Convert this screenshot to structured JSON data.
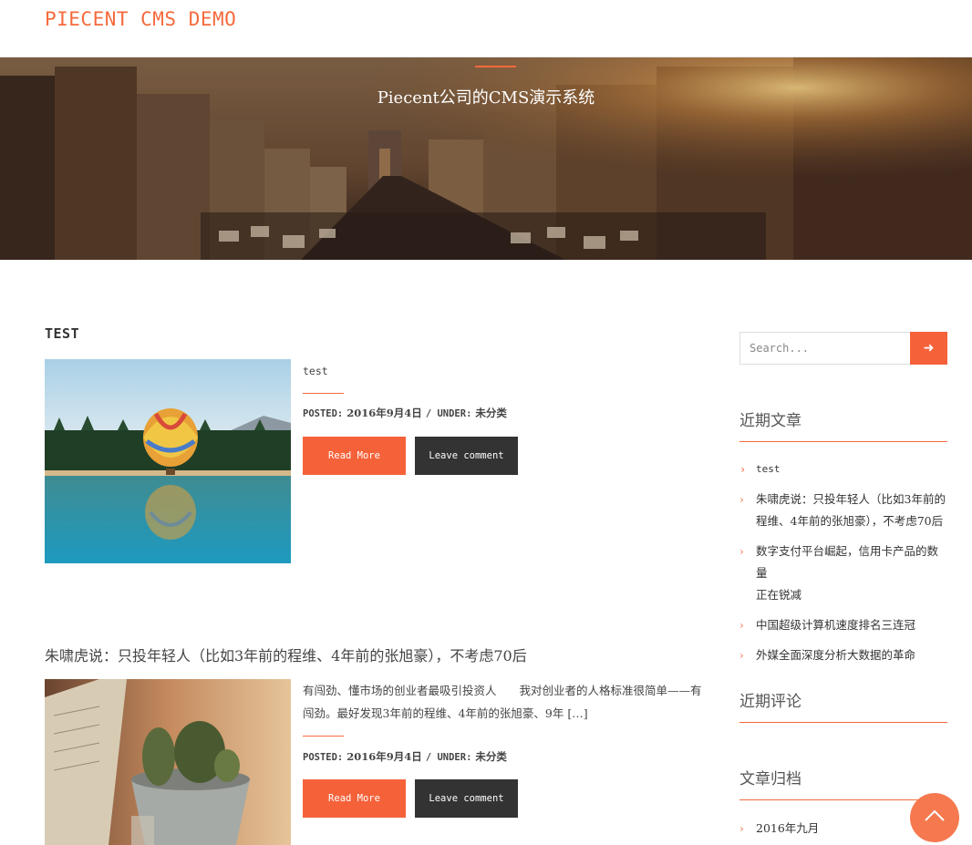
{
  "header": {
    "site_title": "PIECENT CMS DEMO"
  },
  "hero": {
    "tagline": "Piecent公司的CMS演示系统",
    "image": "city-street-sunset-photo"
  },
  "posts": [
    {
      "title": "TEST",
      "thumbnail": "hot-air-balloon-lake-photo",
      "excerpt": "test",
      "meta_posted_label": "POSTED:",
      "meta_date": "2016年9月4日",
      "meta_under_label": "/ UNDER:",
      "meta_category": "未分类",
      "read_more": "Read More",
      "leave_comment": "Leave comment"
    },
    {
      "title": "朱啸虎说：只投年轻人（比如3年前的程维、4年前的张旭豪），不考虑70后",
      "thumbnail": "cactus-pots-photo",
      "excerpt_line1": "有闯劲、懂市场的创业者最吸引投资人　　我对创业者的人格标准很简单——有",
      "excerpt_line2": "闯劲。最好发现3年前的程维、4年前的张旭豪、9年 […]",
      "meta_posted_label": "POSTED:",
      "meta_date": "2016年9月4日",
      "meta_under_label": "/ UNDER:",
      "meta_category": "未分类",
      "read_more": "Read More",
      "leave_comment": "Leave comment"
    }
  ],
  "sidebar": {
    "search": {
      "placeholder": "Search...",
      "icon": "arrow-right-icon"
    },
    "recent_posts_title": "近期文章",
    "recent_posts": [
      {
        "line1": "test"
      },
      {
        "line1": "朱啸虎说：只投年轻人（比如3年前的",
        "line2": "程维、4年前的张旭豪），不考虑70后"
      },
      {
        "line1": "数字支付平台崛起，信用卡产品的数量",
        "line2": "正在锐减"
      },
      {
        "line1": "中国超级计算机速度排名三连冠"
      },
      {
        "line1": "外媒全面深度分析大数据的革命"
      }
    ],
    "recent_comments_title": "近期评论",
    "archives_title": "文章归档",
    "archives": [
      "2016年九月"
    ]
  },
  "colors": {
    "accent": "#f5623a",
    "dark_button": "#333333"
  }
}
